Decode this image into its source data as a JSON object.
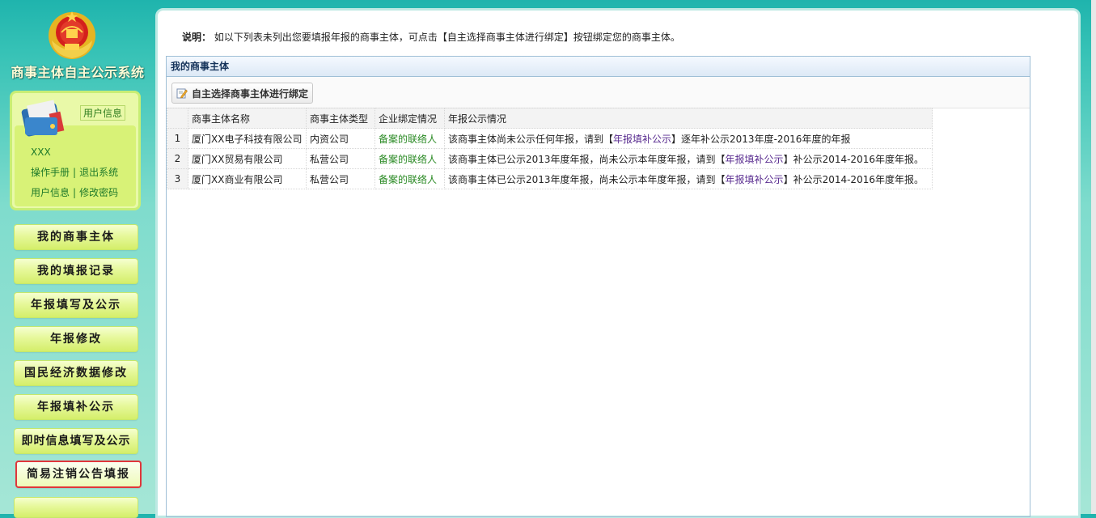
{
  "sidebar": {
    "system_title": "商事主体自主公示系统",
    "user_info_tag": "用户信息",
    "user_name": "XXX",
    "links_row1": [
      "操作手册",
      "退出系统"
    ],
    "links_row2": [
      "用户信息",
      "修改密码"
    ],
    "nav": [
      "我的商事主体",
      "我的填报记录",
      "年报填写及公示",
      "年报修改",
      "国民经济数据修改",
      "年报填补公示",
      "即时信息填写及公示",
      "简易注销公告填报"
    ],
    "active_nav_index": 7
  },
  "notice": {
    "label": "说明：",
    "text": "如以下列表未列出您要填报年报的商事主体，可点击【自主选择商事主体进行绑定】按钮绑定您的商事主体。"
  },
  "panel": {
    "title": "我的商事主体",
    "bind_button": "自主选择商事主体进行绑定",
    "columns": [
      "商事主体名称",
      "商事主体类型",
      "企业绑定情况",
      "年报公示情况"
    ],
    "rows": [
      {
        "num": "1",
        "name": "厦门XX电子科技有限公司",
        "type": "内资公司",
        "binding": "备案的联络人",
        "status_pre": "该商事主体尚未公示任何年报，请到【",
        "status_link": "年报填补公示",
        "status_post": "】逐年补公示2013年度-2016年度的年报"
      },
      {
        "num": "2",
        "name": "厦门XX贸易有限公司",
        "type": "私营公司",
        "binding": "备案的联络人",
        "status_pre": "该商事主体已公示2013年度年报，尚未公示本年度年报，请到【",
        "status_link": "年报填补公示",
        "status_post": "】补公示2014-2016年度年报。"
      },
      {
        "num": "3",
        "name": "厦门XX商业有限公司",
        "type": "私营公司",
        "binding": "备案的联络人",
        "status_pre": "该商事主体已公示2013年度年报，尚未公示本年度年报，请到【",
        "status_link": "年报填补公示",
        "status_post": "】补公示2014-2016年度年报。"
      }
    ]
  },
  "colors": {
    "background_teal": "#36c2b6",
    "nav_button": "#e6f89a",
    "active_border": "#e0363a",
    "link_green": "#2a8a24",
    "link_purple": "#5a2d90"
  }
}
